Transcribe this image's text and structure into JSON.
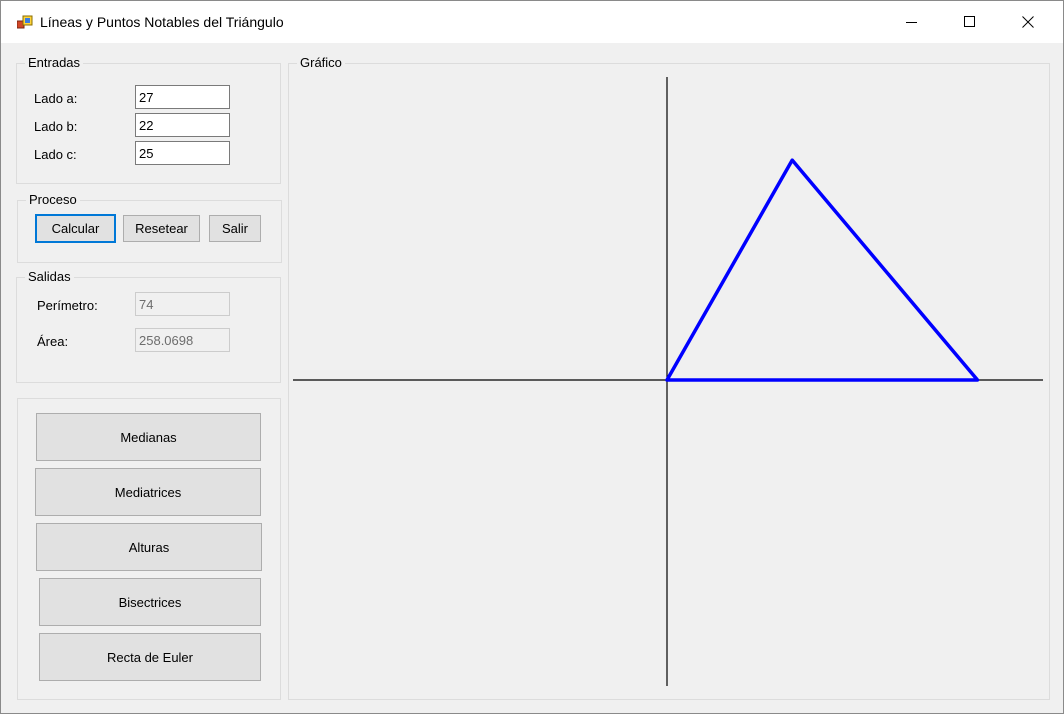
{
  "window": {
    "title": "Líneas y Puntos Notables del Triángulo"
  },
  "entradas": {
    "label": "Entradas",
    "fields": [
      {
        "label": "Lado a:",
        "value": "27"
      },
      {
        "label": "Lado b:",
        "value": "22"
      },
      {
        "label": "Lado c:",
        "value": "25"
      }
    ]
  },
  "proceso": {
    "label": "Proceso",
    "buttons": [
      "Calcular",
      "Resetear",
      "Salir"
    ]
  },
  "salidas": {
    "label": "Salidas",
    "perimetro_label": "Perímetro:",
    "perimetro_value": "74",
    "area_label": "Área:",
    "area_value": "258.0698"
  },
  "lines_panel": {
    "buttons": [
      "Medianas",
      "Mediatrices",
      "Alturas",
      "Bisectrices",
      "Recta de Euler"
    ]
  },
  "grafico": {
    "label": "Gráfico",
    "triangle_color": "#0000ff",
    "axis_color": "#000000",
    "triangle_sides": {
      "a": 27,
      "b": 22,
      "c": 25
    }
  }
}
